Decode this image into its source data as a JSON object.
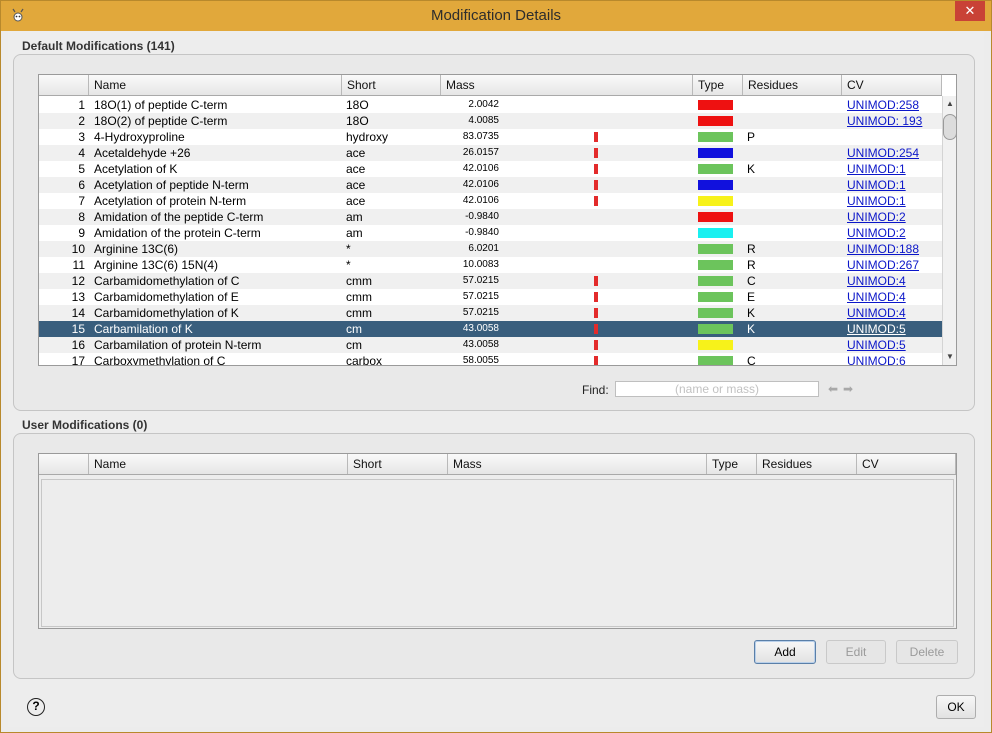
{
  "window": {
    "title": "Modification Details",
    "close_label": "✕"
  },
  "default_section": {
    "label": "Default Modifications (141)",
    "columns": [
      "",
      "Name",
      "Short",
      "Mass",
      "Type",
      "Residues",
      "CV"
    ],
    "rows": [
      {
        "num": "1",
        "name": "18O(1) of peptide C-term",
        "short": "18O",
        "mass": "2.0042",
        "bar": false,
        "type_color": "#ee1111",
        "residues": "",
        "cv": "UNIMOD:258"
      },
      {
        "num": "2",
        "name": "18O(2) of peptide C-term",
        "short": "18O",
        "mass": "4.0085",
        "bar": false,
        "type_color": "#ee1111",
        "residues": "",
        "cv": "UNIMOD: 193"
      },
      {
        "num": "3",
        "name": "4-Hydroxyproline",
        "short": "hydroxy",
        "mass": "83.0735",
        "bar": true,
        "type_color": "#6cc45c",
        "residues": "P",
        "cv": ""
      },
      {
        "num": "4",
        "name": "Acetaldehyde +26",
        "short": "ace",
        "mass": "26.0157",
        "bar": true,
        "type_color": "#1111dd",
        "residues": "",
        "cv": "UNIMOD:254"
      },
      {
        "num": "5",
        "name": "Acetylation of K",
        "short": "ace",
        "mass": "42.0106",
        "bar": true,
        "type_color": "#6cc45c",
        "residues": "K",
        "cv": "UNIMOD:1"
      },
      {
        "num": "6",
        "name": "Acetylation of peptide N-term",
        "short": "ace",
        "mass": "42.0106",
        "bar": true,
        "type_color": "#1111dd",
        "residues": "",
        "cv": "UNIMOD:1"
      },
      {
        "num": "7",
        "name": "Acetylation of protein N-term",
        "short": "ace",
        "mass": "42.0106",
        "bar": true,
        "type_color": "#f7f21a",
        "residues": "",
        "cv": "UNIMOD:1"
      },
      {
        "num": "8",
        "name": "Amidation of the peptide C-term",
        "short": "am",
        "mass": "-0.9840",
        "bar": false,
        "type_color": "#ee1111",
        "residues": "",
        "cv": "UNIMOD:2"
      },
      {
        "num": "9",
        "name": "Amidation of the protein C-term",
        "short": "am",
        "mass": "-0.9840",
        "bar": false,
        "type_color": "#19f0f0",
        "residues": "",
        "cv": "UNIMOD:2"
      },
      {
        "num": "10",
        "name": "Arginine 13C(6)",
        "short": "*",
        "mass": "6.0201",
        "bar": false,
        "type_color": "#6cc45c",
        "residues": "R",
        "cv": "UNIMOD:188"
      },
      {
        "num": "11",
        "name": "Arginine 13C(6) 15N(4)",
        "short": "*",
        "mass": "10.0083",
        "bar": false,
        "type_color": "#6cc45c",
        "residues": "R",
        "cv": "UNIMOD:267"
      },
      {
        "num": "12",
        "name": "Carbamidomethylation of C",
        "short": "cmm",
        "mass": "57.0215",
        "bar": true,
        "type_color": "#6cc45c",
        "residues": "C",
        "cv": "UNIMOD:4"
      },
      {
        "num": "13",
        "name": "Carbamidomethylation of E",
        "short": "cmm",
        "mass": "57.0215",
        "bar": true,
        "type_color": "#6cc45c",
        "residues": "E",
        "cv": "UNIMOD:4"
      },
      {
        "num": "14",
        "name": "Carbamidomethylation of K",
        "short": "cmm",
        "mass": "57.0215",
        "bar": true,
        "type_color": "#6cc45c",
        "residues": "K",
        "cv": "UNIMOD:4"
      },
      {
        "num": "15",
        "name": "Carbamilation of K",
        "short": "cm",
        "mass": "43.0058",
        "bar": true,
        "type_color": "#6cc45c",
        "residues": "K",
        "cv": "UNIMOD:5",
        "selected": true
      },
      {
        "num": "16",
        "name": "Carbamilation of protein N-term",
        "short": "cm",
        "mass": "43.0058",
        "bar": true,
        "type_color": "#f7f21a",
        "residues": "",
        "cv": "UNIMOD:5"
      },
      {
        "num": "17",
        "name": "Carboxymethylation of C",
        "short": "carbox",
        "mass": "58.0055",
        "bar": true,
        "type_color": "#6cc45c",
        "residues": "C",
        "cv": "UNIMOD:6"
      }
    ],
    "find": {
      "label": "Find:",
      "placeholder": "(name or mass)"
    }
  },
  "user_section": {
    "label": "User Modifications (0)",
    "columns": [
      "",
      "Name",
      "Short",
      "Mass",
      "Type",
      "Residues",
      "CV"
    ]
  },
  "buttons": {
    "add": "Add",
    "edit": "Edit",
    "delete": "Delete",
    "ok": "OK",
    "help": "?"
  }
}
